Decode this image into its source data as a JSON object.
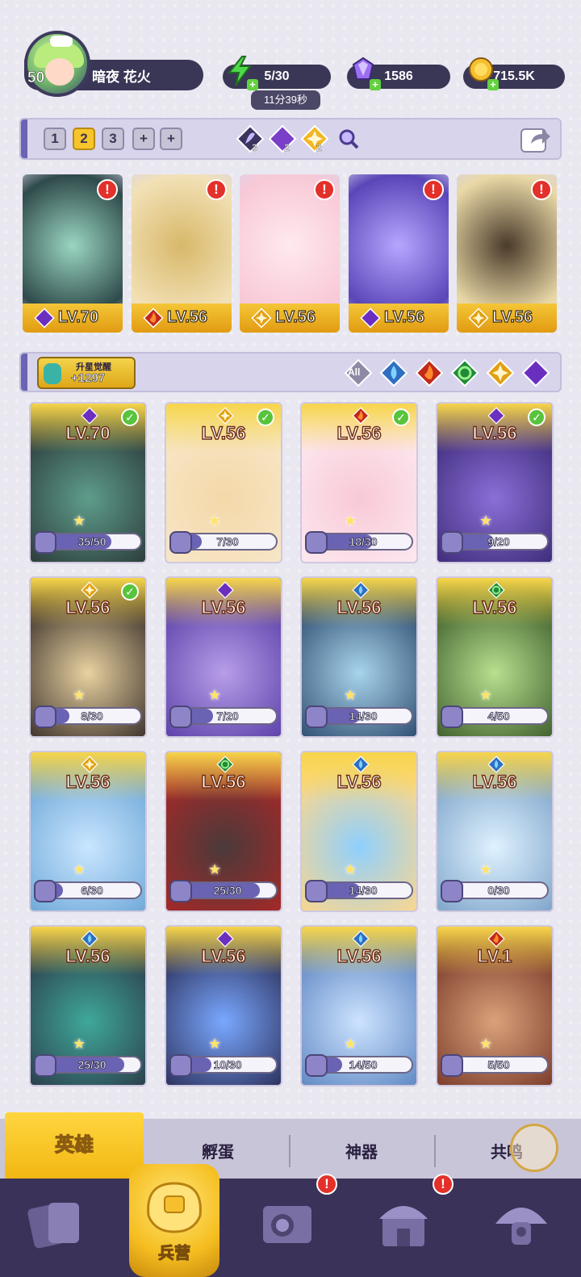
{
  "player": {
    "level": "50",
    "name": "暗夜 花火"
  },
  "resources": {
    "energy": "5/30",
    "energy_timer": "11分39秒",
    "gems": "1586",
    "coins": "715.5K"
  },
  "team_tabs": [
    "1",
    "2",
    "3",
    "+",
    "+"
  ],
  "team_active": "2",
  "element_counts": [
    {
      "icon": "void-element-icon",
      "count": "3"
    },
    {
      "icon": "dark-element-icon",
      "count": "2"
    },
    {
      "icon": "light-element-icon",
      "count": "2"
    }
  ],
  "featured": [
    {
      "level": "LV.70",
      "element": "dark",
      "alert": true
    },
    {
      "level": "LV.56",
      "element": "fire",
      "alert": true
    },
    {
      "level": "LV.56",
      "element": "light",
      "alert": true
    },
    {
      "level": "LV.56",
      "element": "dark",
      "alert": true
    },
    {
      "level": "LV.56",
      "element": "light",
      "alert": true
    }
  ],
  "awaken": {
    "title": "升星觉醒",
    "value": "+1297"
  },
  "filters": [
    "All",
    "water",
    "fire",
    "wind",
    "light",
    "dark"
  ],
  "filter_all_label": "All",
  "heroes": [
    {
      "level": "LV.70",
      "element": "dark",
      "check": true,
      "shards": "35/50",
      "fraction": 0.7
    },
    {
      "level": "LV.56",
      "element": "light",
      "check": true,
      "shards": "7/30",
      "fraction": 0.23
    },
    {
      "level": "LV.56",
      "element": "fire",
      "check": true,
      "shards": "18/30",
      "fraction": 0.6
    },
    {
      "level": "LV.56",
      "element": "dark",
      "check": true,
      "shards": "9/20",
      "fraction": 0.45
    },
    {
      "level": "LV.56",
      "element": "light",
      "check": true,
      "shards": "8/30",
      "fraction": 0.27
    },
    {
      "level": "LV.56",
      "element": "dark",
      "check": false,
      "shards": "7/20",
      "fraction": 0.35
    },
    {
      "level": "LV.56",
      "element": "water",
      "check": false,
      "shards": "14/30",
      "fraction": 0.47
    },
    {
      "level": "LV.56",
      "element": "wind",
      "check": false,
      "shards": "4/50",
      "fraction": 0.08
    },
    {
      "level": "LV.56",
      "element": "light",
      "check": false,
      "shards": "6/30",
      "fraction": 0.2
    },
    {
      "level": "LV.56",
      "element": "wind",
      "check": false,
      "shards": "25/30",
      "fraction": 0.83
    },
    {
      "level": "LV.56",
      "element": "water",
      "check": false,
      "shards": "14/30",
      "fraction": 0.47
    },
    {
      "level": "LV.56",
      "element": "water",
      "check": false,
      "shards": "0/30",
      "fraction": 0.0
    },
    {
      "level": "LV.56",
      "element": "water",
      "check": false,
      "shards": "25/30",
      "fraction": 0.83
    },
    {
      "level": "LV.56",
      "element": "dark",
      "check": false,
      "shards": "10/30",
      "fraction": 0.33
    },
    {
      "level": "LV.56",
      "element": "water",
      "check": false,
      "shards": "14/50",
      "fraction": 0.28
    },
    {
      "level": "LV.1",
      "element": "fire",
      "check": false,
      "shards": "5/50",
      "fraction": 0.1
    }
  ],
  "subtabs": [
    "英雄",
    "孵蛋",
    "神器",
    "共鸣"
  ],
  "subtab_active": "英雄",
  "nav": {
    "active_label": "兵营"
  },
  "colors": {
    "accent_yellow": "#f5c638",
    "panel_purple": "#3a3656",
    "alert_red": "#e3302a",
    "check_green": "#58c33c",
    "fire": "#e8472b",
    "water": "#3fa8e8",
    "wind": "#3fbd57",
    "light": "#f3b623",
    "dark": "#8a4fd4"
  }
}
